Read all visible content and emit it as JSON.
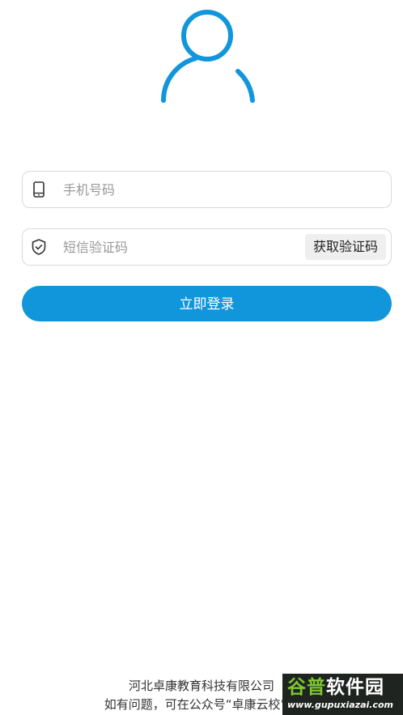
{
  "colors": {
    "accent": "#1296db",
    "border": "#d9d9d9",
    "placeholder": "#999999",
    "code_button_bg": "#efefef"
  },
  "header": {
    "avatar_icon": "user-avatar-icon"
  },
  "form": {
    "phone": {
      "icon": "mobile-phone-icon",
      "placeholder": "手机号码",
      "value": ""
    },
    "code": {
      "icon": "shield-check-icon",
      "placeholder": "短信验证码",
      "value": "",
      "get_code_label": "获取验证码"
    },
    "login_label": "立即登录"
  },
  "footer": {
    "company": "河北卓康教育科技有限公司",
    "help": "如有问题，可在公众号“卓康云校”上"
  },
  "watermark": {
    "title_accent": "谷普",
    "title_rest": "软件园",
    "url": "www.gupuxiazai.com"
  }
}
